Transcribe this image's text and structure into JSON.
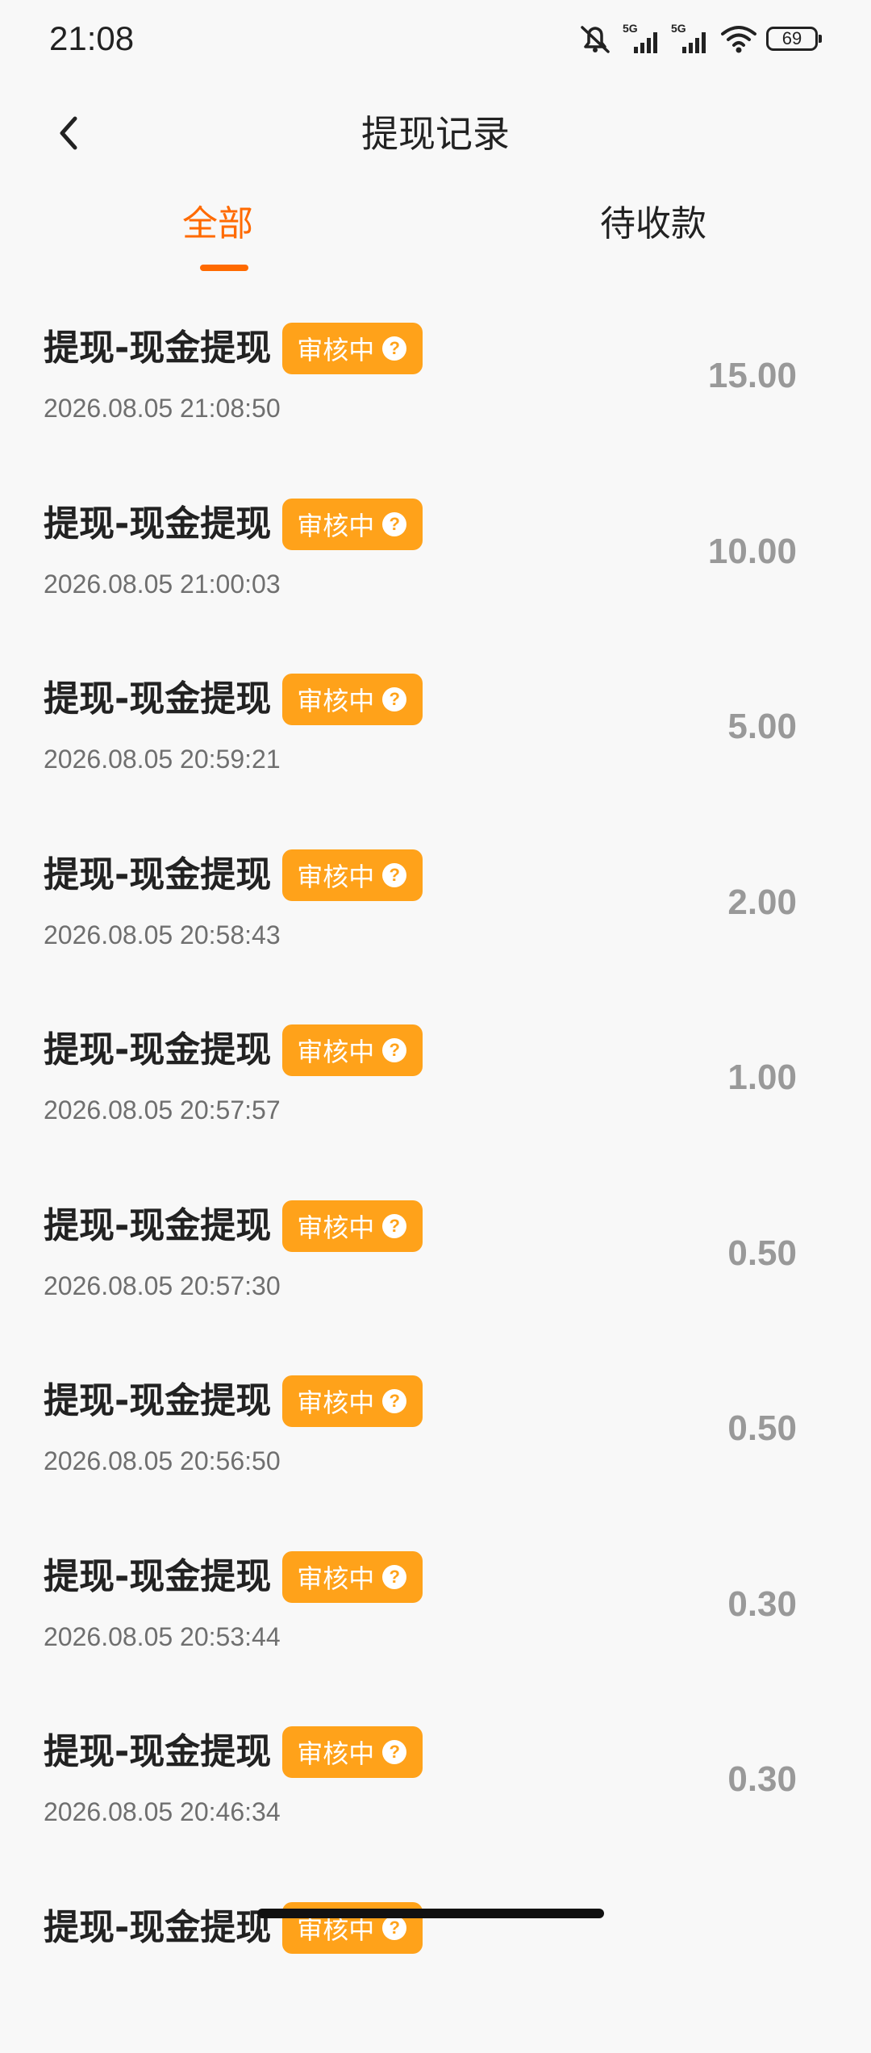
{
  "status_bar": {
    "time": "21:08",
    "battery": "69",
    "icons": [
      "mute-bell-icon",
      "5g-signal-icon",
      "5g-signal-icon",
      "wifi-icon",
      "battery-icon"
    ]
  },
  "header": {
    "title": "提现记录",
    "back_icon": "chevron-left-icon"
  },
  "tabs": [
    {
      "label": "全部",
      "active": true
    },
    {
      "label": "待收款",
      "active": false
    }
  ],
  "colors": {
    "accent": "#ff6a00",
    "badge": "#ffa21a",
    "amount": "#999999"
  },
  "records": [
    {
      "title": "提现-现金提现",
      "status": "审核中",
      "time": "2026.08.05 21:08:50",
      "amount": "15.00"
    },
    {
      "title": "提现-现金提现",
      "status": "审核中",
      "time": "2026.08.05 21:00:03",
      "amount": "10.00"
    },
    {
      "title": "提现-现金提现",
      "status": "审核中",
      "time": "2026.08.05 20:59:21",
      "amount": "5.00"
    },
    {
      "title": "提现-现金提现",
      "status": "审核中",
      "time": "2026.08.05 20:58:43",
      "amount": "2.00"
    },
    {
      "title": "提现-现金提现",
      "status": "审核中",
      "time": "2026.08.05 20:57:57",
      "amount": "1.00"
    },
    {
      "title": "提现-现金提现",
      "status": "审核中",
      "time": "2026.08.05 20:57:30",
      "amount": "0.50"
    },
    {
      "title": "提现-现金提现",
      "status": "审核中",
      "time": "2026.08.05 20:56:50",
      "amount": "0.50"
    },
    {
      "title": "提现-现金提现",
      "status": "审核中",
      "time": "2026.08.05 20:53:44",
      "amount": "0.30"
    },
    {
      "title": "提现-现金提现",
      "status": "审核中",
      "time": "2026.08.05 20:46:34",
      "amount": "0.30"
    },
    {
      "title": "提现-现金提现",
      "status": "审核中",
      "time": "",
      "amount": ""
    }
  ]
}
